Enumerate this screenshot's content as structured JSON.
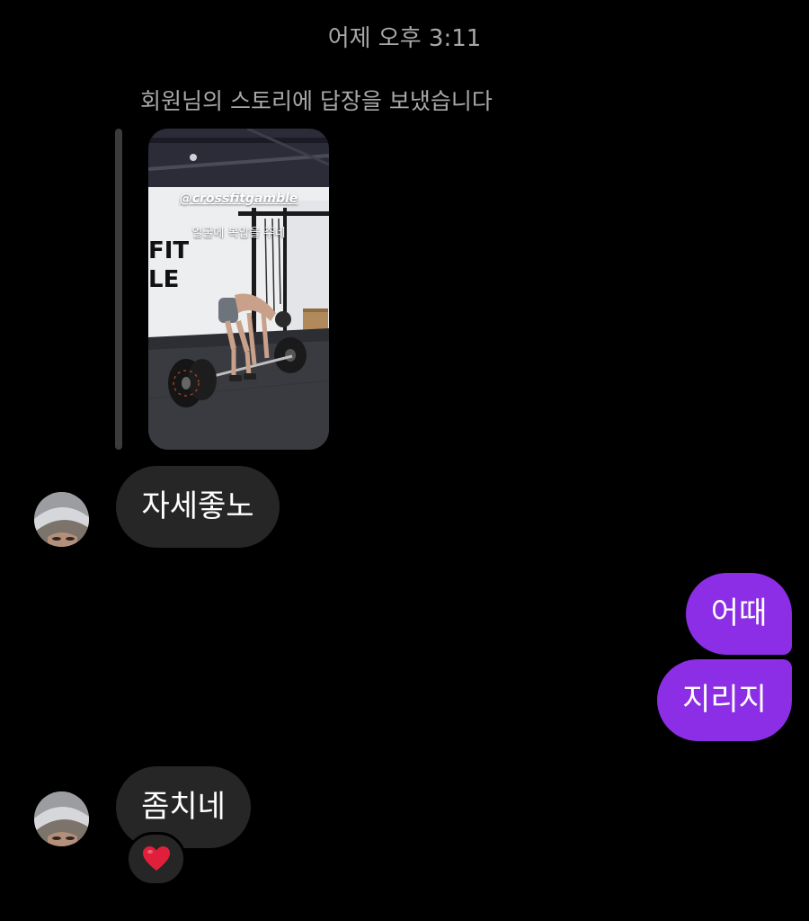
{
  "thread": {
    "timestamp": "어제 오후 3:11",
    "story_reply_note": "회원님의 스토리에 답장을 보냈습니다"
  },
  "story": {
    "handle": "@crossfitgamble",
    "caption": "얼굴에 복압을 주네",
    "wall_sign_line1": "FIT",
    "wall_sign_line2": "LE"
  },
  "messages": [
    {
      "id": "m1",
      "direction": "incoming",
      "text": "자세좋노"
    },
    {
      "id": "m2",
      "direction": "outgoing",
      "text": "어때"
    },
    {
      "id": "m3",
      "direction": "outgoing",
      "text": "지리지"
    },
    {
      "id": "m4",
      "direction": "incoming",
      "text": "좀치네",
      "reaction": "heart-icon"
    }
  ],
  "colors": {
    "background": "#000000",
    "incoming_bubble": "#262626",
    "outgoing_bubble": "#8b2ee6",
    "meta_text": "#a8a8a8",
    "reaction_heart": "#e0203a"
  }
}
